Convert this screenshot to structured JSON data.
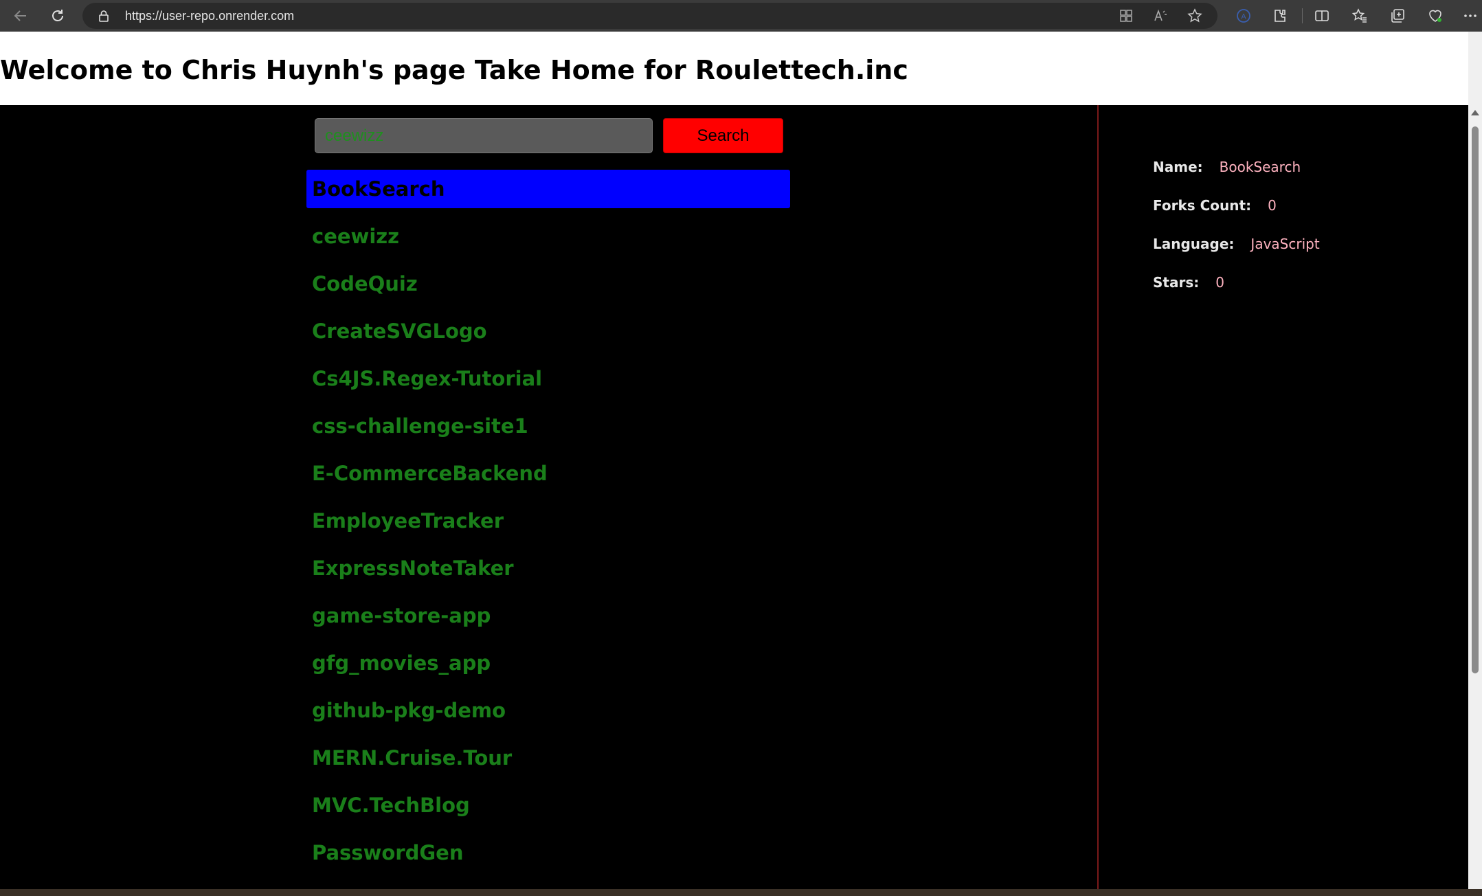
{
  "browser": {
    "url": "https://user-repo.onrender.com",
    "icons": [
      "back-icon",
      "refresh-icon",
      "lock-icon",
      "app-grid-icon",
      "read-aloud-icon",
      "favorite-star-icon",
      "profile-icon",
      "extensions-icon",
      "split-screen-icon",
      "favorites-icon",
      "collections-icon",
      "health-icon",
      "more-icon"
    ]
  },
  "page": {
    "title": "Welcome to Chris Huynh's page Take Home for Roulettech.inc"
  },
  "search": {
    "value": "ceewizz",
    "button_label": "Search"
  },
  "repos": [
    "BookSearch",
    "ceewizz",
    "CodeQuiz",
    "CreateSVGLogo",
    "Cs4JS.Regex-Tutorial",
    "css-challenge-site1",
    "E-CommerceBackend",
    "EmployeeTracker",
    "ExpressNoteTaker",
    "game-store-app",
    "gfg_movies_app",
    "github-pkg-demo",
    "MERN.Cruise.Tour",
    "MVC.TechBlog",
    "PasswordGen"
  ],
  "selected_repo_index": 0,
  "details": {
    "name_label": "Name:",
    "name_value": "BookSearch",
    "forks_label": "Forks Count:",
    "forks_value": "0",
    "language_label": "Language:",
    "language_value": "JavaScript",
    "stars_label": "Stars:",
    "stars_value": "0"
  },
  "colors": {
    "selected_bg": "#0000ff",
    "repo_text": "#1a7f1a",
    "search_button": "#ff0000",
    "detail_value": "#ffb3c0"
  }
}
